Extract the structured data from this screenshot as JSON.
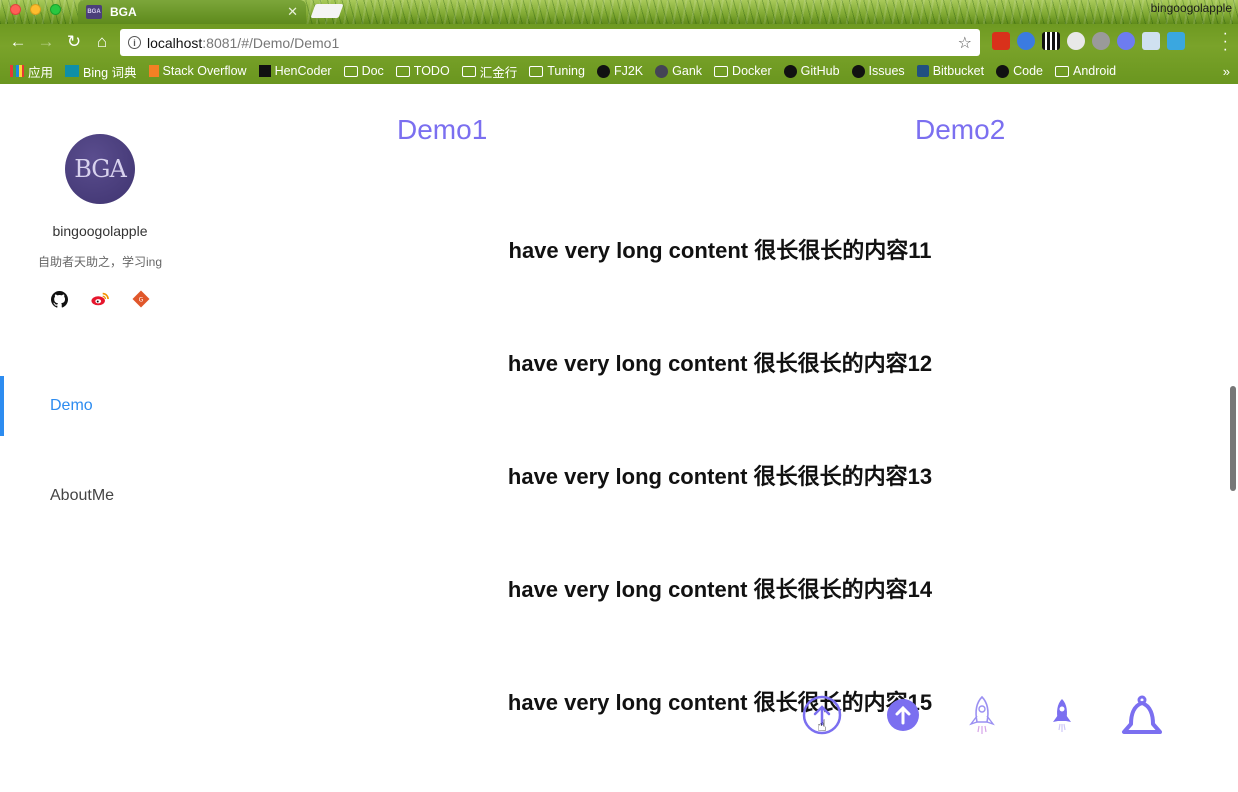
{
  "browser": {
    "tab_title": "BGA",
    "tab_favicon_text": "BGA",
    "profile_name": "bingoogolapple",
    "url_host": "localhost",
    "url_rest": ":8081/#/Demo/Demo1",
    "bookmarks": [
      {
        "label": "应用",
        "icon": "apps-grid-icon"
      },
      {
        "label": "Bing 词典",
        "icon": "bing-icon"
      },
      {
        "label": "Stack Overflow",
        "icon": "stackoverflow-icon"
      },
      {
        "label": "HenCoder",
        "icon": "hencoder-icon"
      },
      {
        "label": "Doc",
        "icon": "folder-icon"
      },
      {
        "label": "TODO",
        "icon": "folder-icon"
      },
      {
        "label": "汇金行",
        "icon": "folder-icon"
      },
      {
        "label": "Tuning",
        "icon": "folder-icon"
      },
      {
        "label": "FJ2K",
        "icon": "github-icon"
      },
      {
        "label": "Gank",
        "icon": "gank-icon"
      },
      {
        "label": "Docker",
        "icon": "folder-icon"
      },
      {
        "label": "GitHub",
        "icon": "github-icon"
      },
      {
        "label": "Issues",
        "icon": "github-icon"
      },
      {
        "label": "Bitbucket",
        "icon": "bitbucket-icon"
      },
      {
        "label": "Code",
        "icon": "github-icon"
      },
      {
        "label": "Android",
        "icon": "folder-icon"
      }
    ],
    "more_label": "»"
  },
  "sidebar": {
    "avatar_text": "BGA",
    "username": "bingoogolapple",
    "motto": "自助者天助之，学习ing",
    "social": [
      "github-icon",
      "weibo-icon",
      "gitosc-icon"
    ],
    "nav": [
      {
        "label": "Demo",
        "active": true
      },
      {
        "label": "AboutMe",
        "active": false
      }
    ]
  },
  "main": {
    "tabs": [
      "Demo1",
      "Demo2"
    ],
    "lines": [
      "have very long content 很长很长的内容11",
      "have very long content 很长很长的内容12",
      "have very long content 很长很长的内容13",
      "have very long content 很长很长的内容14",
      "have very long content 很长很长的内容15"
    ],
    "back_to_top_buttons": [
      "arrow-up-circle-outline-icon",
      "arrow-up-circle-filled-icon",
      "rocket-outline-icon",
      "rocket-filled-icon",
      "rocket-bell-icon"
    ]
  },
  "colors": {
    "accent": "#7b6ff0",
    "active_nav": "#2d8cf0"
  }
}
